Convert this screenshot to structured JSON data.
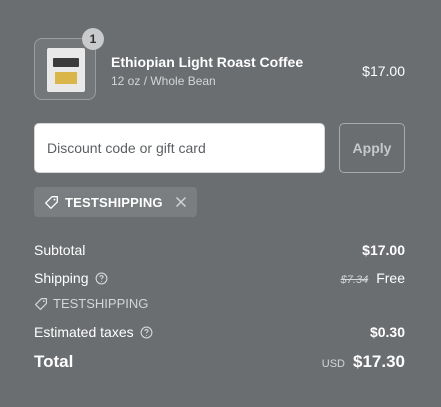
{
  "product": {
    "name": "Ethiopian Light Roast Coffee",
    "variant": "12 oz / Whole Bean",
    "price": "$17.00",
    "quantity": "1"
  },
  "discount": {
    "placeholder": "Discount code or gift card",
    "value": "",
    "apply_label": "Apply",
    "applied_code": "TESTSHIPPING"
  },
  "summary": {
    "subtotal_label": "Subtotal",
    "subtotal_value": "$17.00",
    "shipping_label": "Shipping",
    "shipping_original": "$7.34",
    "shipping_value": "Free",
    "shipping_code": "TESTSHIPPING",
    "taxes_label": "Estimated taxes",
    "taxes_value": "$0.30",
    "total_label": "Total",
    "total_currency": "USD",
    "total_value": "$17.30"
  },
  "icons": {
    "tag": "tag-icon",
    "remove": "close-icon",
    "info": "info-icon"
  },
  "colors": {
    "background": "#6b6e71",
    "text": "#ffffff",
    "muted_text": "#d3d5d7",
    "chip_background": "#7b7e81"
  }
}
